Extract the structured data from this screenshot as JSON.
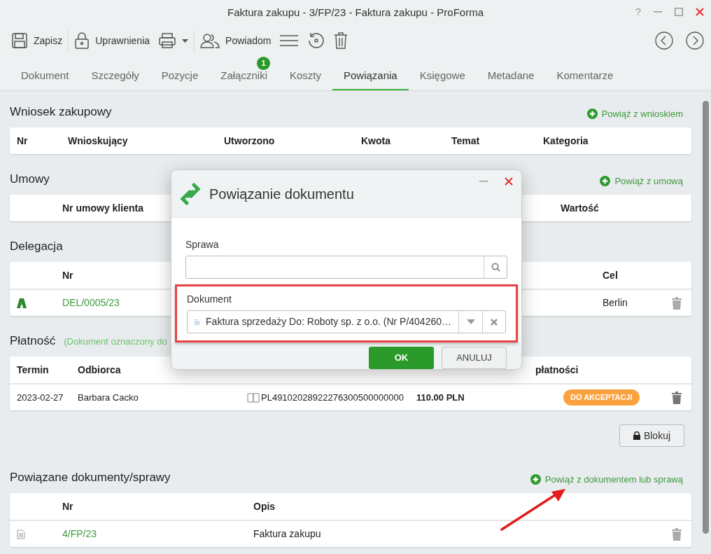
{
  "window": {
    "title": "Faktura zakupu - 3/FP/23 - Faktura zakupu - ProForma",
    "help": "?"
  },
  "toolbar": [
    {
      "kind": "save",
      "label": "Zapisz"
    },
    {
      "kind": "lock",
      "label": "Uprawnienia"
    },
    {
      "kind": "print"
    },
    {
      "kind": "notify",
      "label": "Powiadom"
    },
    {
      "kind": "menu"
    },
    {
      "kind": "restore"
    },
    {
      "kind": "delete"
    }
  ],
  "tabs": [
    {
      "label": "Dokument",
      "selected": false
    },
    {
      "label": "Szczegóły",
      "selected": false
    },
    {
      "label": "Pozycje",
      "selected": false
    },
    {
      "label": "Załączniki",
      "selected": false,
      "badge": "1"
    },
    {
      "label": "Koszty",
      "selected": false
    },
    {
      "label": "Powiązania",
      "selected": true
    },
    {
      "label": "Księgowe",
      "selected": false
    },
    {
      "label": "Metadane",
      "selected": false
    },
    {
      "label": "Komentarze",
      "selected": false
    }
  ],
  "sections": [
    {
      "kind": "requests",
      "title": "Wniosek zakupowy",
      "link": "Powiąż z wnioskiem",
      "columns": [
        "Nr",
        "Wnioskujący",
        "Utworzono",
        "Kwota",
        "Temat",
        "Kategoria"
      ]
    },
    {
      "kind": "contracts",
      "title": "Umowy",
      "link": "Powiąż z umową",
      "columns": [
        "Nr umowy klienta",
        "Wartość"
      ]
    },
    {
      "kind": "delegation",
      "title": "Delegacja",
      "columns": [
        "Nr",
        "Cel"
      ],
      "rows": [
        {
          "cells": [
            "DEL/0005/23",
            "Berlin"
          ]
        }
      ]
    },
    {
      "kind": "payment",
      "title": "Płatność",
      "note": "(Dokument oznaczony do",
      "columns": [
        "Termin",
        "Odbiorca",
        "płatności"
      ],
      "rows": [
        {
          "cells": [
            "2023-02-27",
            "Barbara Cacko",
            "PL49102028922276300500000000",
            "110.00 PLN"
          ],
          "status": {
            "label": "DO AKCEPTACJI",
            "color": "#f9a23f"
          }
        }
      ],
      "action": "Blokuj"
    },
    {
      "kind": "related",
      "title": "Powiązane dokumenty/sprawy",
      "link": "Powiąż z dokumentem lub sprawą",
      "columns": [
        "Nr",
        "Opis"
      ],
      "rows": [
        {
          "cells": [
            "4/FP/23",
            "Faktura zakupu"
          ]
        }
      ]
    }
  ],
  "dialog": {
    "title": "Powiązanie dokumentu",
    "fields": [
      {
        "kind": "search",
        "label": "Sprawa",
        "highlighted": false
      },
      {
        "kind": "select",
        "label": "Dokument",
        "value": "Faktura sprzedaży Do: Roboty sp. z o.o. (Nr P/404260…",
        "highlighted": true
      }
    ],
    "buttons": [
      {
        "label": "OK",
        "primary": true
      },
      {
        "label": "ANULUJ",
        "primary": false
      }
    ]
  }
}
